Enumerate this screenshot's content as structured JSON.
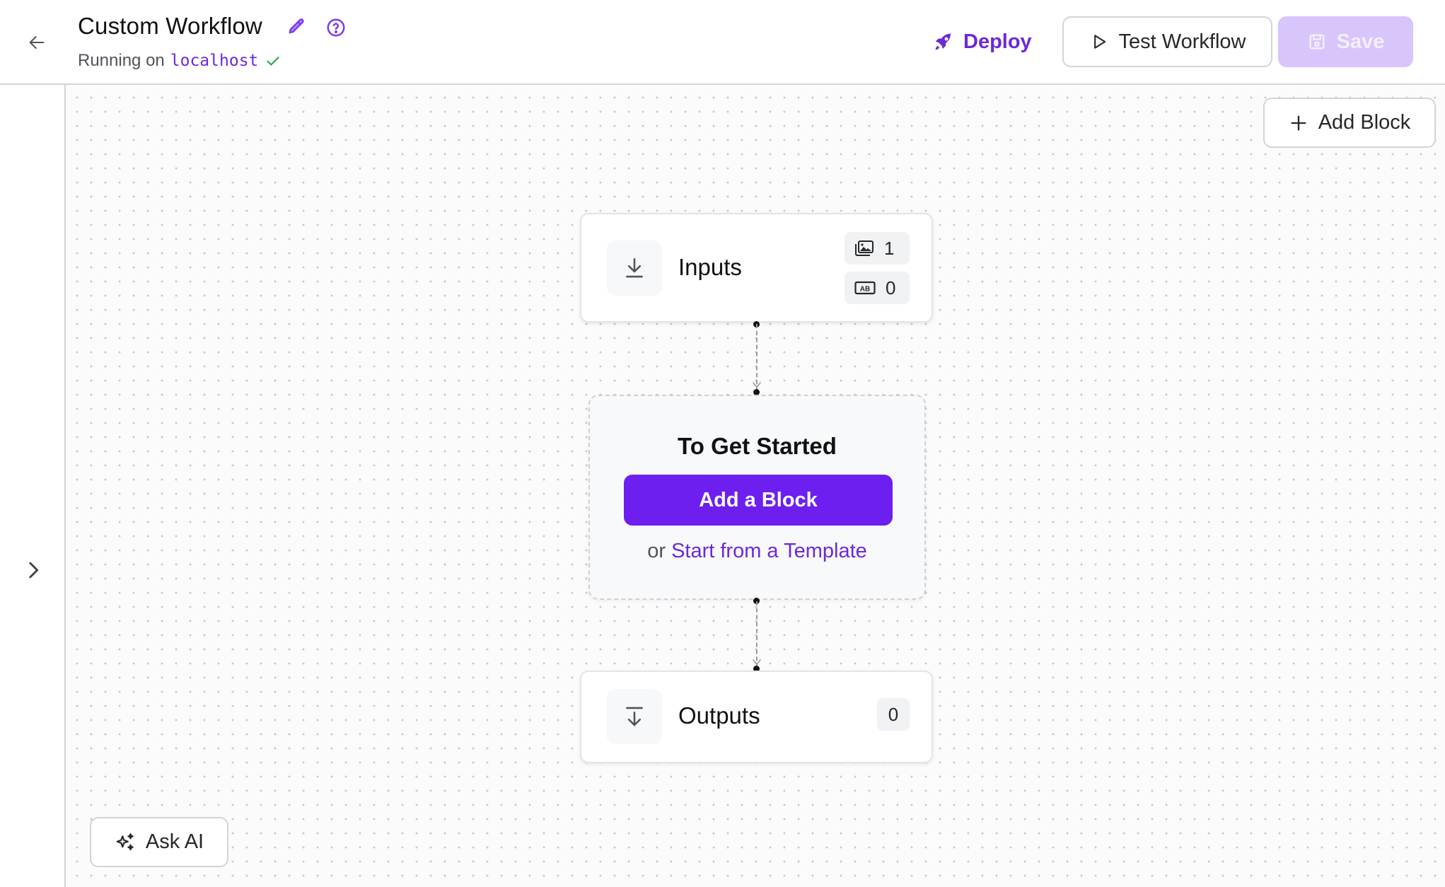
{
  "header": {
    "back_label": "Back",
    "title": "Custom Workflow",
    "status_prefix": "Running on",
    "host": "localhost",
    "deploy_label": "Deploy",
    "test_label": "Test Workflow",
    "save_label": "Save"
  },
  "canvas": {
    "add_block_label": "Add Block",
    "inputs_node": {
      "label": "Inputs",
      "badges": [
        {
          "icon": "images-icon",
          "count": "1"
        },
        {
          "icon": "text-ab-icon",
          "count": "0"
        }
      ]
    },
    "start_node": {
      "title": "To Get Started",
      "primary_label": "Add a Block",
      "alt_prefix": "or",
      "alt_link": "Start from a Template"
    },
    "outputs_node": {
      "label": "Outputs",
      "count": "0"
    },
    "ask_ai_label": "Ask AI"
  },
  "colors": {
    "accent": "#6d1ff0",
    "accent_text": "#6d28d9",
    "save_disabled": "#d8c5fb",
    "success": "#16a34a"
  }
}
